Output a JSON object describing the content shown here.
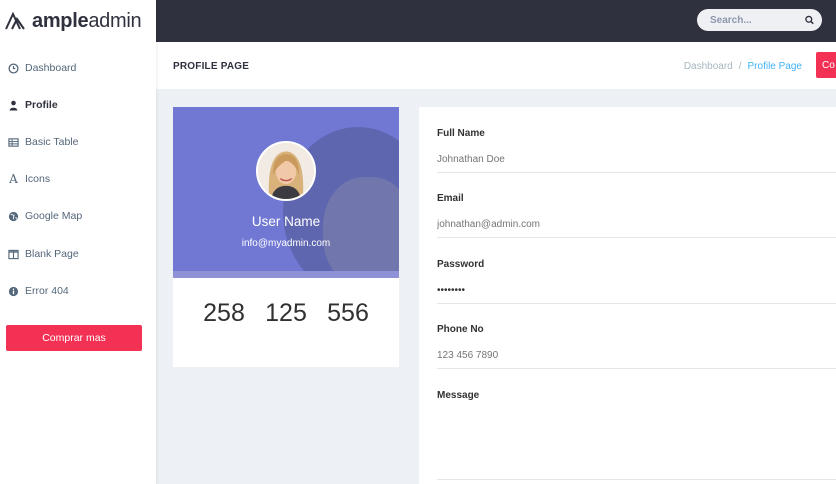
{
  "brand": {
    "bold": "ample",
    "light": "admin"
  },
  "sidebar": {
    "items": [
      {
        "label": "Dashboard",
        "icon": "clock-icon"
      },
      {
        "label": "Profile",
        "icon": "user-icon"
      },
      {
        "label": "Basic Table",
        "icon": "table-icon"
      },
      {
        "label": "Icons",
        "icon": "font-icon"
      },
      {
        "label": "Google Map",
        "icon": "globe-icon"
      },
      {
        "label": "Blank Page",
        "icon": "columns-icon"
      },
      {
        "label": "Error 404",
        "icon": "info-icon"
      }
    ],
    "active_index": 1,
    "cta_label": "Comprar mas"
  },
  "topbar": {
    "search_placeholder": "Search..."
  },
  "titlebar": {
    "title": "PROFILE PAGE",
    "breadcrumb": [
      "Dashboard",
      "Profile Page"
    ],
    "separator": "/",
    "button_label": "Co"
  },
  "profile": {
    "name": "User Name",
    "email": "info@myadmin.com",
    "stats": [
      "258",
      "125",
      "556"
    ]
  },
  "form": {
    "full_name": {
      "label": "Full Name",
      "placeholder": "Johnathan Doe"
    },
    "email": {
      "label": "Email",
      "placeholder": "johnathan@admin.com"
    },
    "password": {
      "label": "Password",
      "value": "password"
    },
    "phone": {
      "label": "Phone No",
      "placeholder": "123 456 7890"
    },
    "message": {
      "label": "Message",
      "placeholder": ""
    }
  },
  "colors": {
    "sidebar_bg": "#ffffff",
    "topbar_bg": "#2f323e",
    "accent": "#f33155",
    "profile_bg": "#7178d4",
    "link_active": "#41b3f9",
    "page_bg": "#edf1f5"
  }
}
